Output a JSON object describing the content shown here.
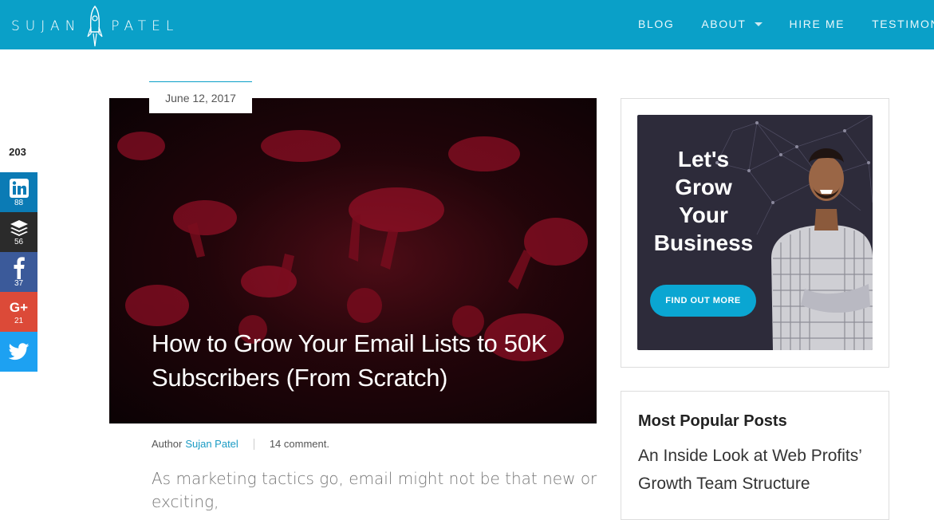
{
  "brand": {
    "left": "SUJAN",
    "right": "PATEL"
  },
  "nav": [
    {
      "label": "BLOG"
    },
    {
      "label": "ABOUT"
    },
    {
      "label": "HIRE ME"
    },
    {
      "label": "TESTIMON"
    }
  ],
  "share": {
    "total": "203",
    "linkedin": "88",
    "buffer": "56",
    "facebook": "37",
    "googleplus": "21",
    "googleplus_glyph": "G+"
  },
  "post": {
    "date": "June 12, 2017",
    "title": "How to Grow Your Email Lists to 50K Subscribers (From Scratch)",
    "author_label": "Author",
    "author_name": "Sujan Patel",
    "comments": "14 comment.",
    "excerpt": "As marketing tactics go, email might not be that new or exciting,"
  },
  "sidebar": {
    "ad_headline_1": "Let's",
    "ad_headline_2": "Grow",
    "ad_headline_3": "Your",
    "ad_headline_4": "Business",
    "ad_button": "FIND OUT MORE",
    "popular_title": "Most Popular Posts",
    "popular_first": "An Inside Look at Web Profits’ Growth Team Structure"
  },
  "colors": {
    "header": "#0aa0c8",
    "linkedin": "#0b7bb5",
    "buffer": "#2b2b2b",
    "facebook": "#3b5a9a",
    "googleplus": "#dc4a38",
    "twitter": "#1da1f2"
  }
}
